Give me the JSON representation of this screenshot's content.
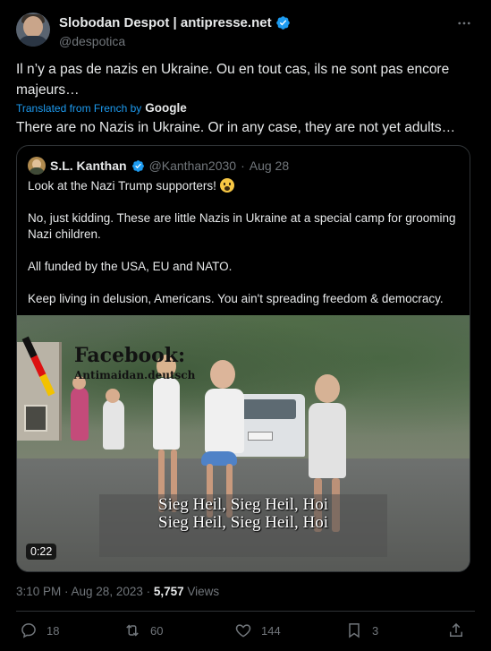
{
  "author": {
    "display_name": "Slobodan Despot | antipresse.net",
    "handle": "@despotica"
  },
  "tweet": {
    "text": "Il n’y a pas de nazis en Ukraine. Ou en tout cas, ils ne sont pas encore majeurs…",
    "translated_label": "Translated from French by",
    "translated_provider": "Google",
    "translation": "There are no Nazis in Ukraine. Or in any case, they are not yet adults…"
  },
  "quoted": {
    "display_name": "S.L. Kanthan",
    "handle": "@Kanthan2030",
    "separator": "·",
    "date": "Aug 28",
    "paragraphs": [
      "Look at the Nazi Trump supporters!",
      "No, just kidding. These are little Nazis in Ukraine at a special camp for grooming Nazi children.",
      "All funded by the USA, EU and NATO.",
      "Keep living in delusion, Americans. You ain't spreading freedom & democracy."
    ],
    "video": {
      "watermark_title": "Facebook:",
      "watermark_sub": "Antimaidan.deutsch",
      "caption_line1": "Sieg Heil, Sieg Heil, Hoi",
      "caption_line2": "Sieg Heil, Sieg Heil, Hoi",
      "duration": "0:22"
    }
  },
  "meta": {
    "time_date": "3:10 PM · Aug 28, 2023 · ",
    "views_count": "5,757",
    "views_label": " Views"
  },
  "actions": {
    "replies": "18",
    "reposts": "60",
    "likes": "144",
    "bookmarks": "3"
  },
  "colors": {
    "background": "#000000",
    "text": "#e7e9ea",
    "secondary": "#71767b",
    "accent": "#1d9bf0",
    "border": "#2f3336"
  },
  "icons": [
    "verified-badge-icon",
    "more-icon",
    "reply-icon",
    "repost-icon",
    "like-icon",
    "bookmark-icon",
    "share-icon",
    "scream-emoji"
  ]
}
